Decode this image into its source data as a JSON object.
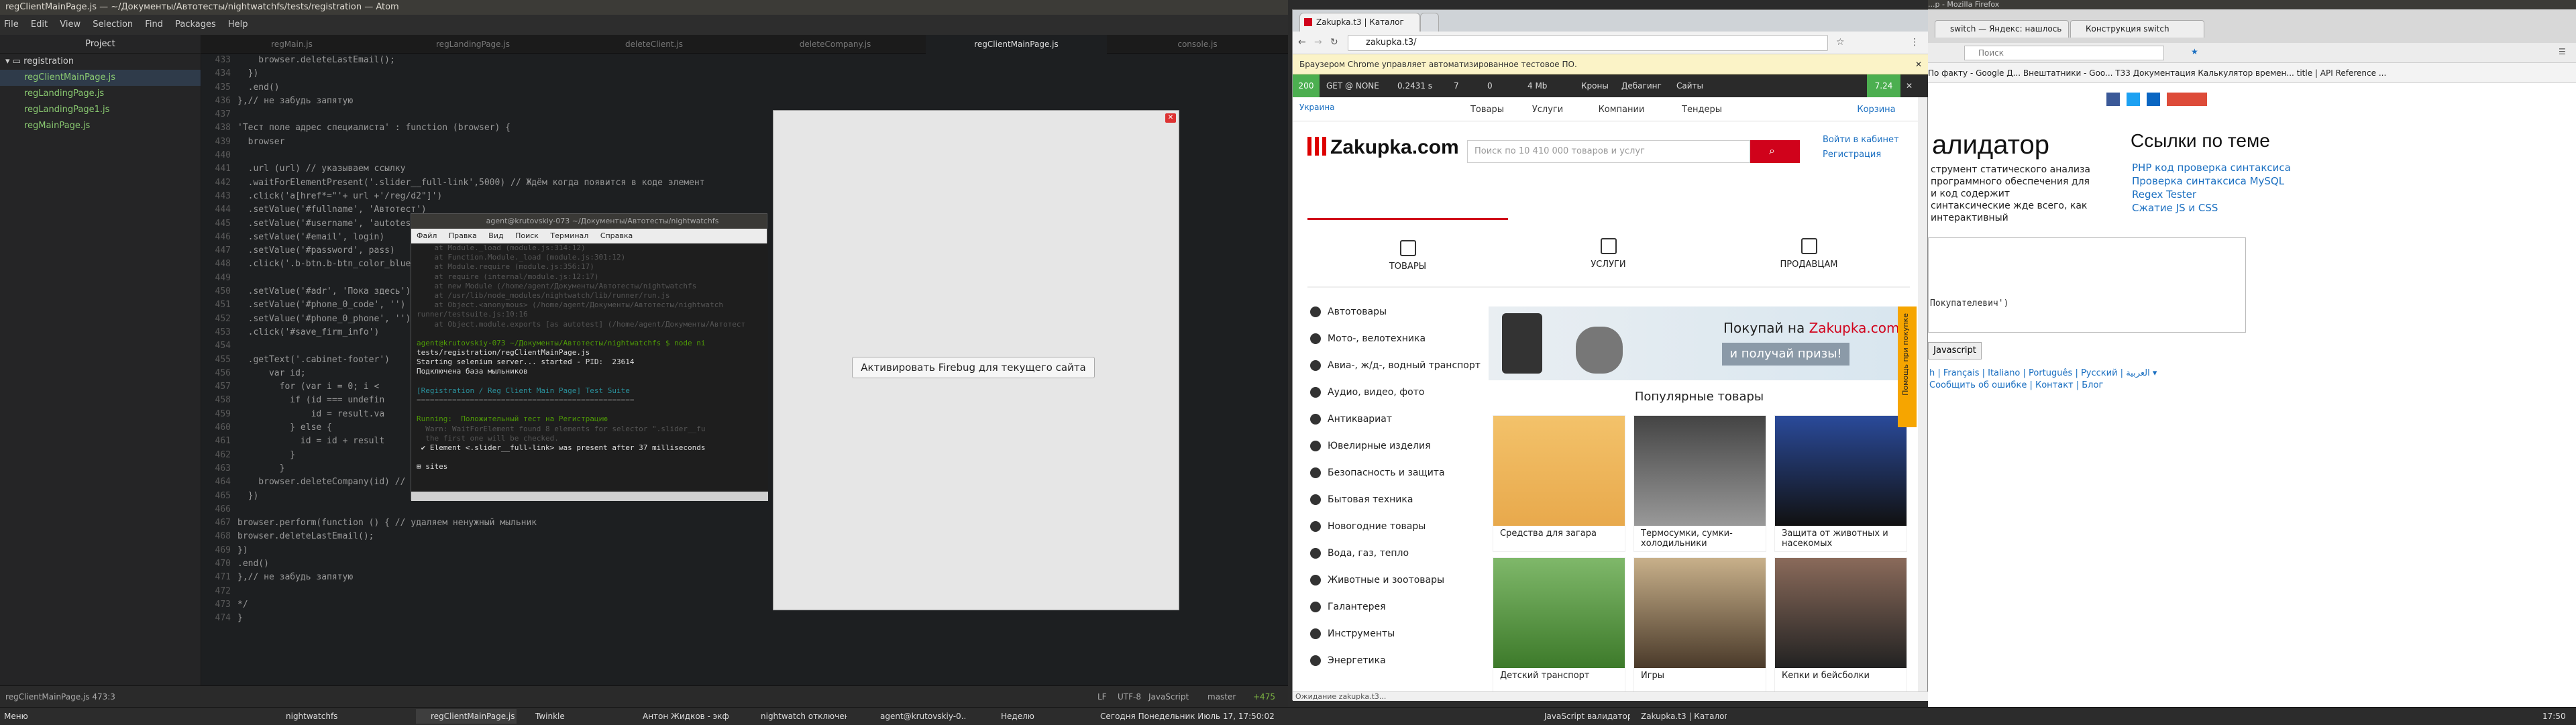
{
  "atom": {
    "title": "regClientMainPage.js — ~/Документы/Автотесты/nightwatchfs/tests/registration — Atom",
    "menu": [
      "File",
      "Edit",
      "View",
      "Selection",
      "Find",
      "Packages",
      "Help"
    ],
    "project_label": "Project",
    "tree_folder": "registration",
    "tree_files": [
      "regClientMainPage.js",
      "regLandingPage.js",
      "regLandingPage1.js",
      "regMainPage.js"
    ],
    "tabs": [
      "regMain.js",
      "regLandingPage.js",
      "deleteClient.js",
      "deleteCompany.js",
      "regClientMainPage.js",
      "console.js"
    ],
    "line_numbers": [
      "433",
      "434",
      "435",
      "436",
      "437",
      "438",
      "439",
      "440",
      "441",
      "442",
      "443",
      "444",
      "445",
      "446",
      "447",
      "448",
      "449",
      "450",
      "451",
      "452",
      "453",
      "454",
      "455",
      "456",
      "457",
      "458",
      "459",
      "460",
      "461",
      "462",
      "463",
      "464",
      "465",
      "466",
      "467",
      "468",
      "469",
      "470",
      "471",
      "472",
      "473",
      "474"
    ],
    "code": [
      "    browser.deleteLastEmail();",
      "  })",
      "  .end()",
      "},// не забудь запятую",
      "",
      "'Тест поле адрес специалиста' : function (browser) {",
      "  browser",
      "",
      "  .url (url) // указываем ссылку",
      "  .waitForElementPresent('.slider__full-link',5000) // Ждём когда появится в коде элемент",
      "  .click('a[href*=\"'+ url +'/reg/d2\"]')",
      "  .setValue('#fullname', 'Автотест')",
      "  .setValue('#username', 'autotest')",
      "  .setValue('#email', login)",
      "  .setValue('#password', pass)",
      "  .click('.b-btn.b-btn_color_blue')",
      "",
      "  .setValue('#adr', 'Пока здесь')",
      "  .setValue('#phone_0_code', '')",
      "  .setValue('#phone_0_phone', '')",
      "  .click('#save_firm_info')",
      "",
      "  .getText('.cabinet-footer')",
      "      var id;",
      "        for (var i = 0; i <",
      "          if (id === undefin",
      "              id = result.va",
      "          } else {",
      "            id = id + result",
      "          }",
      "        }",
      "    browser.deleteCompany(id) // удаляем фирму",
      "  })",
      "",
      "browser.perform(function () { // удаляем ненужный мыльник",
      "browser.deleteLastEmail();",
      "})",
      ".end()",
      "},// не забудь запятую",
      "",
      "*/",
      "}"
    ],
    "status_left": "regClientMainPage.js   473:3",
    "status_right": [
      "LF",
      "UTF-8",
      "JavaScript",
      "master",
      "+475"
    ]
  },
  "firebug_dialog": {
    "button": "Активировать Firebug для текущего сайта"
  },
  "terminal": {
    "title": "agent@krutovskiy-073 ~/Документы/Автотесты/nightwatchfs",
    "menu": [
      "Файл",
      "Правка",
      "Вид",
      "Поиск",
      "Терминал",
      "Справка"
    ],
    "lines": [
      {
        "t": "    at Module._load (module.js:314:12)",
        "c": "dim"
      },
      {
        "t": "    at Function.Module._load (module.js:301:12)",
        "c": "dim"
      },
      {
        "t": "    at Module.require (module.js:356:17)",
        "c": "dim"
      },
      {
        "t": "    at require (internal/module.js:12:17)",
        "c": "dim"
      },
      {
        "t": "    at new Module (/home/agent/Документы/Автотесты/nightwatchfs",
        "c": "dim"
      },
      {
        "t": "    at /usr/lib/node_modules/nightwatch/lib/runner/run.js",
        "c": "dim"
      },
      {
        "t": "    at Object.<anonymous> (/home/agent/Документы/Автотесты/nightwatch",
        "c": "dim"
      },
      {
        "t": "runner/testsuite.js:10:16",
        "c": "dim"
      },
      {
        "t": "    at Object.module.exports [as autotest] (/home/agent/Документы/Автотест",
        "c": "dim"
      },
      {
        "t": "",
        "c": ""
      },
      {
        "t": "agent@krutovskiy-073 ~/Документы/Автотесты/nightwatchfs $ node ni",
        "c": "grn"
      },
      {
        "t": "tests/registration/regClientMainPage.js",
        "c": ""
      },
      {
        "t": "Starting selenium server... started - PID:  23614",
        "c": ""
      },
      {
        "t": "Подключена база мыльников",
        "c": ""
      },
      {
        "t": "",
        "c": ""
      },
      {
        "t": "[Registration / Reg Client Main Page] Test Suite",
        "c": "cyn"
      },
      {
        "t": "=================================================",
        "c": "dim"
      },
      {
        "t": "",
        "c": ""
      },
      {
        "t": "Running:  Положительный тест на Регистрацию",
        "c": "grn"
      },
      {
        "t": "  Warn: WaitForElement found 8 elements for selector \".slider__fu",
        "c": "dim"
      },
      {
        "t": "  the first one will be checked.",
        "c": "dim"
      },
      {
        "t": " ✔ Element <.slider__full-link> was present after 37 milliseconds",
        "c": ""
      },
      {
        "t": "",
        "c": ""
      },
      {
        "t": "⊞ sites",
        "c": ""
      }
    ]
  },
  "chrome": {
    "tab": "Zakupka.t3 | Каталог",
    "url": "zakupka.t3/",
    "infobar": "Браузером Chrome управляет автоматизированное тестовое ПО.",
    "devbar": [
      "200",
      "GET @ NONE",
      "0.2431 s",
      "7",
      "0",
      "4 Mb",
      "Кроны",
      "Дебагинг",
      "Сайты",
      "7.24"
    ],
    "region": "Украина",
    "top_nav": [
      "Товары",
      "Услуги",
      "Компании",
      "Тендеры"
    ],
    "cart": "Корзина",
    "login": "Войти в кабинет",
    "register": "Регистрация",
    "logo": "Zakupka.com",
    "search_placeholder": "Поиск по 10 410 000 товаров и услуг",
    "main_tabs": [
      "ТОВАРЫ",
      "УСЛУГИ",
      "ПРОДАВЦАМ"
    ],
    "categories": [
      "Автотовары",
      "Мото-, велотехника",
      "Авиа-, ж/д-, водный транспорт",
      "Аудио, видео, фото",
      "Антиквариат",
      "Ювелирные изделия",
      "Безопасность и защита",
      "Бытовая техника",
      "Новогодние товары",
      "Вода, газ, тепло",
      "Животные и зоотовары",
      "Галантерея",
      "Инструменты",
      "Энергетика"
    ],
    "banner_text": "Покупай на",
    "banner_logo": "Zakupka.com",
    "banner_badge": "и получай призы!",
    "popular_title": "Популярные товары",
    "products": [
      "Средства для загара",
      "Термосумки, сумки-холодильники",
      "Защита от животных и насекомых",
      "Детский транспорт",
      "Игры",
      "Кепки и бейсболки"
    ],
    "feedback": "Помощь при покупке",
    "status": "Ожидание zakupka.t3..."
  },
  "firefox": {
    "title": "...p - Mozilla Firefox",
    "tabs": [
      "switch — Яндекс: нашлось",
      "Конструкция switch"
    ],
    "search_placeholder": "Поиск",
    "bookmarks": "По факту - Google Д...   Внештатники - Goo...   T33   Документация   Калькулятор времен...   title | API Reference ...",
    "heading": "алидатор",
    "description": "струмент статического анализа программного обеспечения для и код содержит синтаксические жде всего, как интерактивный",
    "links_heading": "Ссылки по теме",
    "links": [
      "PHP код проверка синтаксиса",
      "Проверка синтаксиса MySQL",
      "Regex Tester",
      "Сжатие JS и CSS"
    ],
    "textarea_tail": "Покупателевич')",
    "button": "Javascript",
    "lang_line": "h | Français | Italiano | Português | Русский | العربية ▾",
    "lang_line2": "Сообщить об ошибке | Контакт | Блог"
  },
  "panel": {
    "menu": "Меню",
    "items": [
      "nightwatchfs",
      "regClientMainPage.js",
      "Twinkle",
      "Антон Жидков - экф...",
      "nightwatch отключен д...",
      "agent@krutovskiy-0...",
      "Неделю",
      "Zakupka.t3 | Каталог...",
      "JavaScript валидатор"
    ],
    "clock_mid": "Сегодня Понедельник Июль 17, 17:50:02",
    "clock_right": "17:50"
  },
  "colors": {
    "accent": "#d0021b",
    "devbar_ok": "#4caf50",
    "atom_bg": "#1d1f21"
  }
}
